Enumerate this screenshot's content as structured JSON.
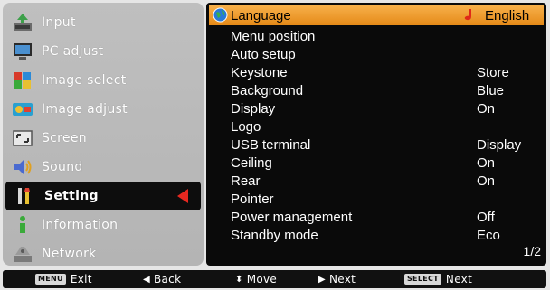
{
  "left_menu": {
    "items": [
      {
        "label": "Input",
        "icon": "input-icon"
      },
      {
        "label": "PC adjust",
        "icon": "pc-adjust-icon"
      },
      {
        "label": "Image select",
        "icon": "image-select-icon"
      },
      {
        "label": "Image adjust",
        "icon": "image-adjust-icon"
      },
      {
        "label": "Screen",
        "icon": "screen-icon"
      },
      {
        "label": "Sound",
        "icon": "sound-icon"
      },
      {
        "label": "Setting",
        "icon": "setting-icon",
        "active": true
      },
      {
        "label": "Information",
        "icon": "information-icon"
      },
      {
        "label": "Network",
        "icon": "network-icon"
      }
    ]
  },
  "settings": {
    "rows": [
      {
        "label": "Language",
        "value": "English"
      },
      {
        "label": "Menu position",
        "value": ""
      },
      {
        "label": "Auto setup",
        "value": ""
      },
      {
        "label": "Keystone",
        "value": "Store"
      },
      {
        "label": "Background",
        "value": "Blue"
      },
      {
        "label": "Display",
        "value": "On"
      },
      {
        "label": "Logo",
        "value": ""
      },
      {
        "label": "USB terminal",
        "value": "Display"
      },
      {
        "label": "Ceiling",
        "value": "On"
      },
      {
        "label": "Rear",
        "value": "On"
      },
      {
        "label": "Pointer",
        "value": ""
      },
      {
        "label": "Power management",
        "value": "Off"
      },
      {
        "label": "Standby mode",
        "value": "Eco"
      }
    ],
    "page": "1/2"
  },
  "bottom_bar": {
    "exit": {
      "key": "MENU",
      "label": "Exit"
    },
    "back": {
      "label": "Back"
    },
    "move": {
      "label": "Move"
    },
    "next": {
      "label": "Next"
    },
    "select_next": {
      "key": "SELECT",
      "label": "Next"
    }
  },
  "colors": {
    "highlight": "#f0a035",
    "panel": "#0a0a0a",
    "menu_bg": "#bababa",
    "marker": "#e62820"
  }
}
